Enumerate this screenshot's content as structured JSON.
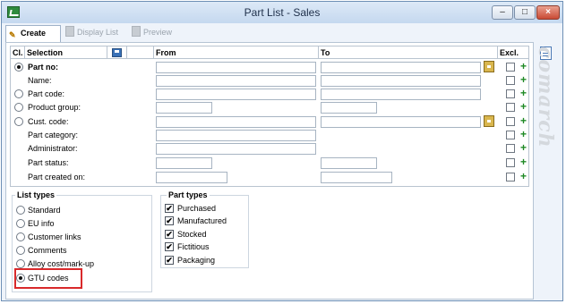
{
  "window": {
    "title": "Part List - Sales",
    "minimize": "‒",
    "maximize": "□",
    "close": "×"
  },
  "toolbar": {
    "create": "Create",
    "display_list": "Display List",
    "preview": "Preview"
  },
  "grid": {
    "headers": {
      "cl": "Cl.",
      "selection": "Selection",
      "from": "From",
      "to": "To",
      "excl": "Excl."
    },
    "rows": [
      {
        "label": "Part no:"
      },
      {
        "label": "Name:"
      },
      {
        "label": "Part code:"
      },
      {
        "label": "Product group:"
      },
      {
        "label": "Cust. code:"
      },
      {
        "label": "Part category:"
      },
      {
        "label": "Administrator:"
      },
      {
        "label": "Part status:"
      },
      {
        "label": "Part created on:"
      }
    ],
    "plus": "+"
  },
  "list_types": {
    "title": "List types",
    "items": [
      "Standard",
      "EU info",
      "Customer links",
      "Comments",
      "Alloy cost/mark-up",
      "GTU codes"
    ],
    "selected": "GTU codes"
  },
  "part_types": {
    "title": "Part types",
    "check": "✔",
    "items": [
      "Purchased",
      "Manufactured",
      "Stocked",
      "Fictitious",
      "Packaging"
    ]
  },
  "watermark": "comarch"
}
